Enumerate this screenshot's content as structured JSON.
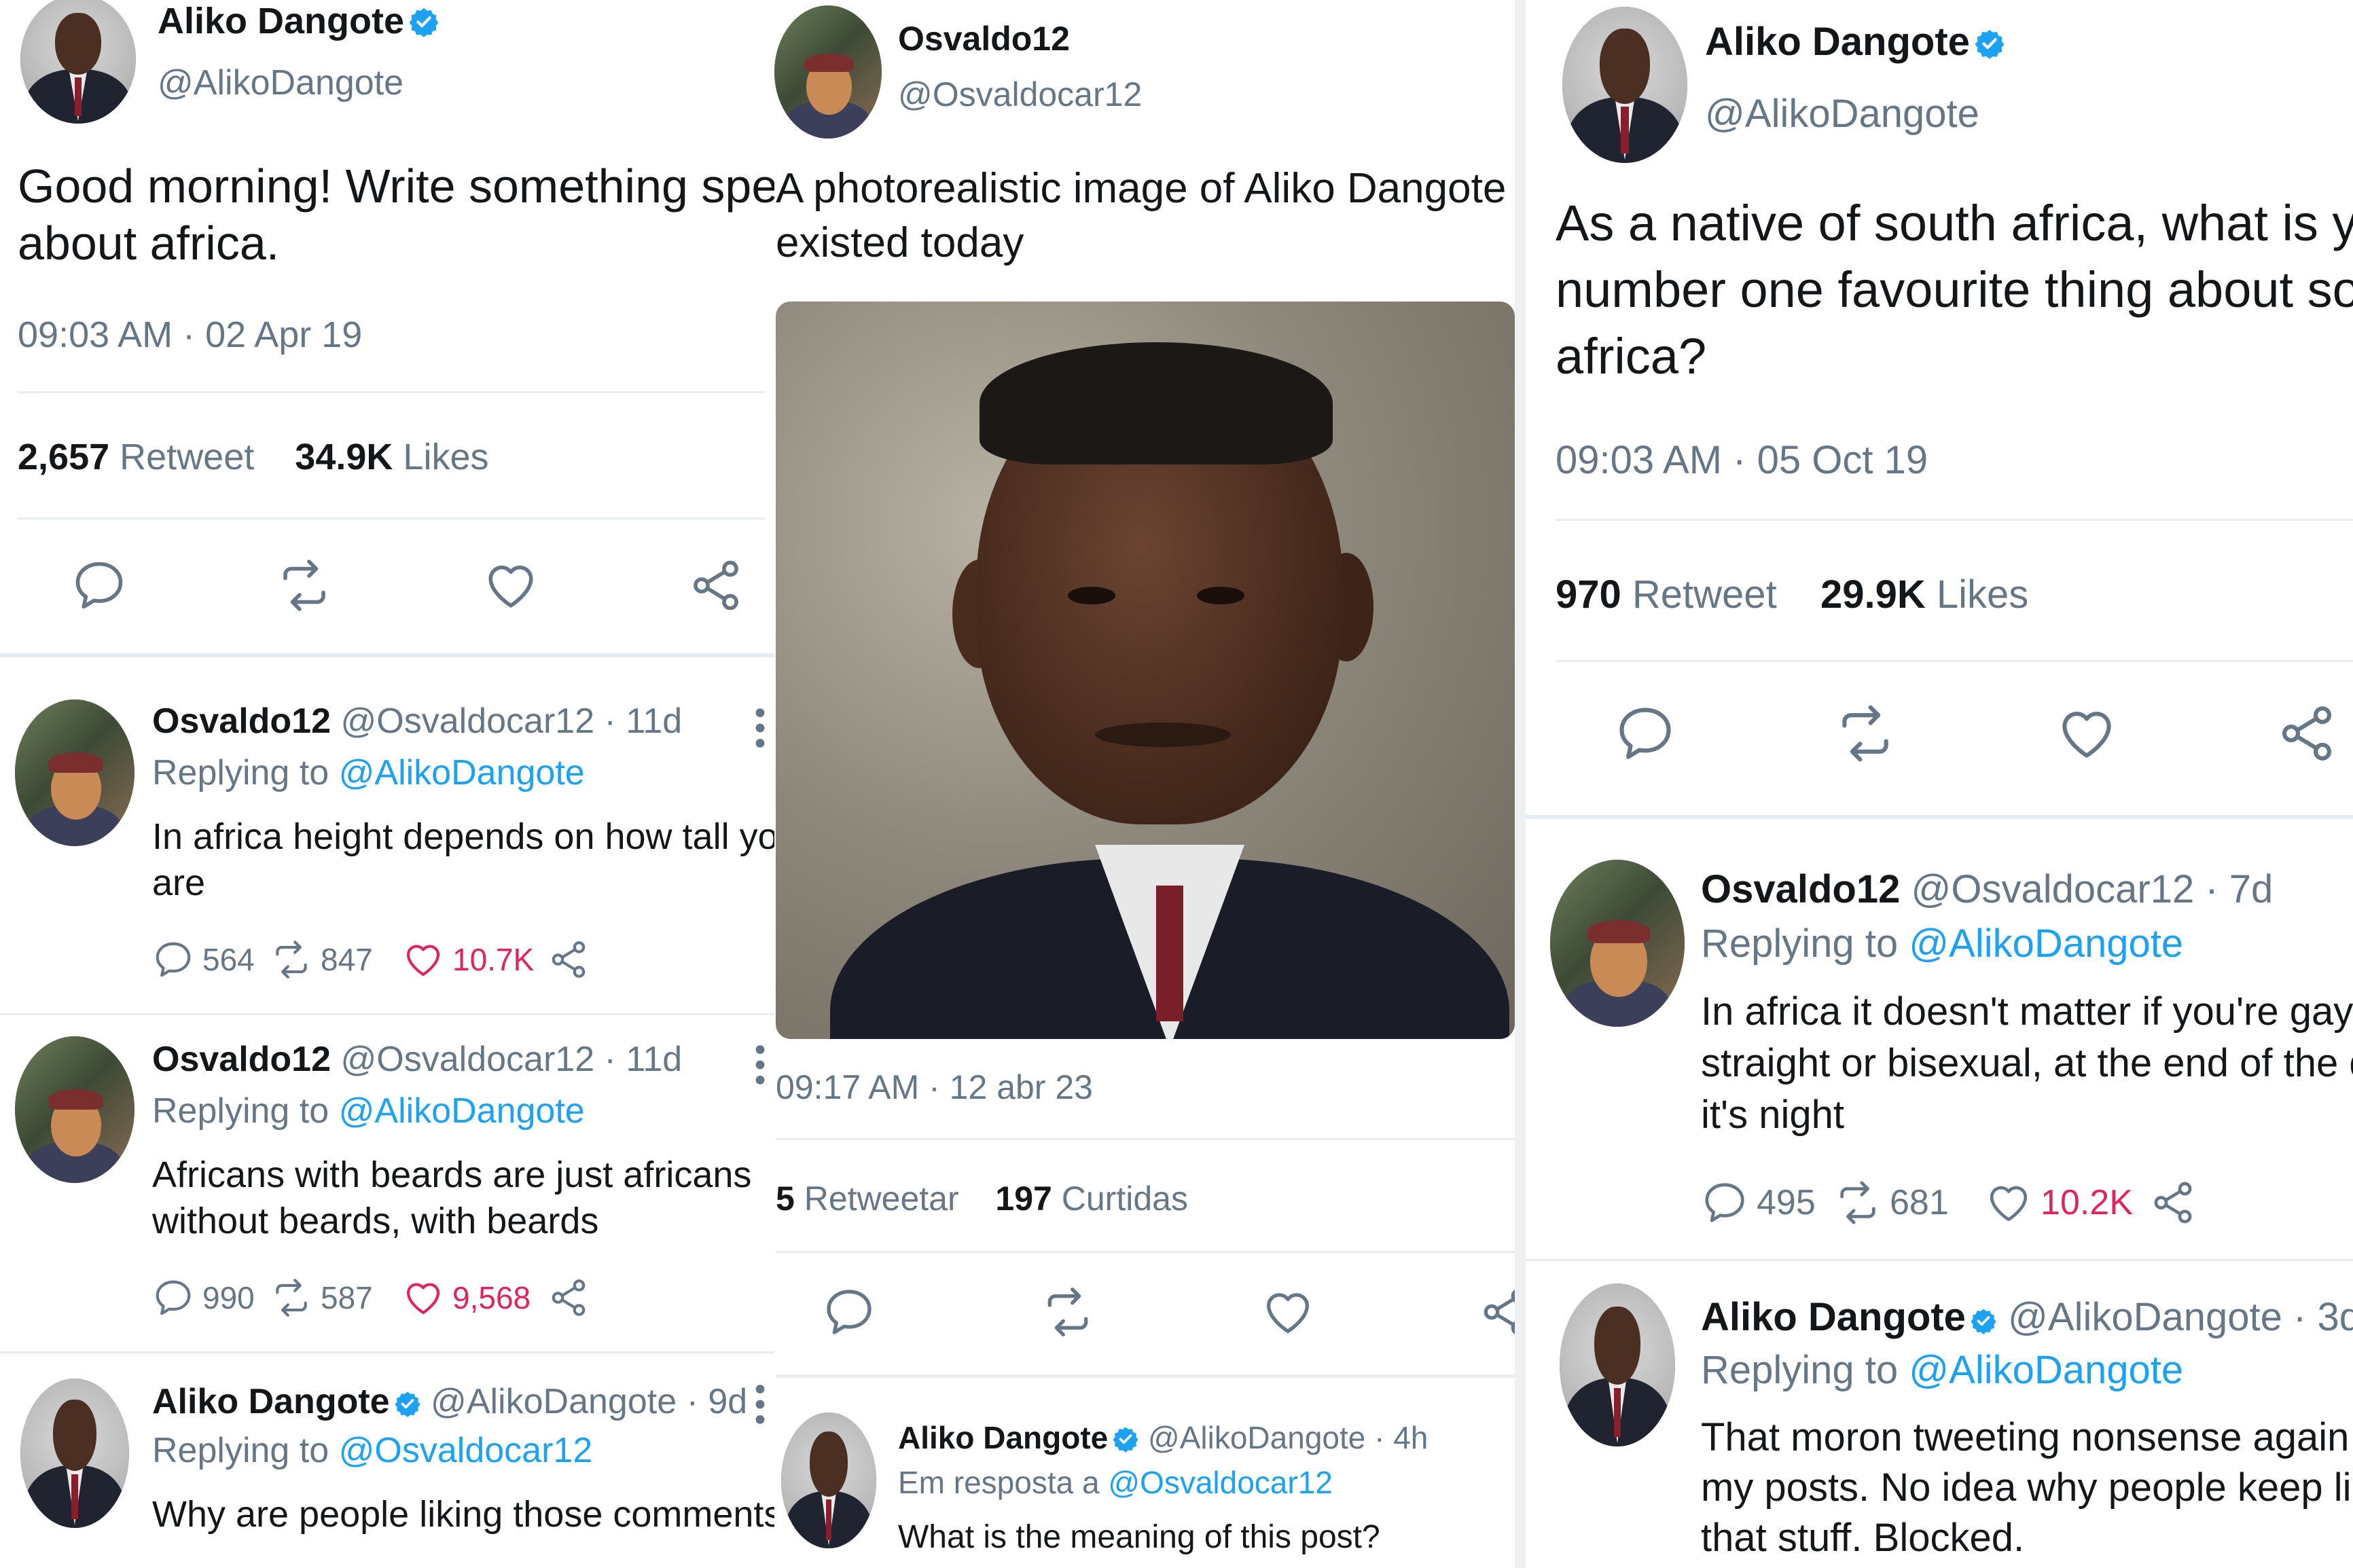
{
  "colors": {
    "accent": "#1da1f2",
    "like_red": "#e0245e",
    "muted": "#657786",
    "verified": "#1da1f2"
  },
  "left": {
    "tweet": {
      "name": "Aliko Dangote",
      "handle": "@AlikoDangote",
      "text_line1": "Good morning! Write something special",
      "text_line2": "about africa.",
      "timestamp": "09:03 AM · 02 Apr 19",
      "retweet_count": "2,657",
      "retweet_label": "Retweet",
      "likes_count": "34.9K",
      "likes_label": "Likes"
    },
    "replies": [
      {
        "name": "Osvaldo12",
        "meta": "@Osvaldocar12 · 11d",
        "replying_prefix": "Replying to",
        "replying_to": "@AlikoDangote",
        "line1": "In africa height depends on how tall you",
        "line2": "are",
        "replies": "564",
        "retweets": "847",
        "likes": "10.7K"
      },
      {
        "name": "Osvaldo12",
        "meta": "@Osvaldocar12 · 11d",
        "replying_prefix": "Replying to",
        "replying_to": "@AlikoDangote",
        "line1": "Africans with beards are just africans",
        "line2": "without beards, with beards",
        "replies": "990",
        "retweets": "587",
        "likes": "9,568"
      },
      {
        "name": "Aliko Dangote",
        "meta": "@AlikoDangote · 9d",
        "replying_prefix": "Replying to",
        "replying_to": "@Osvaldocar12",
        "line1": "Why are people liking those comments?"
      }
    ]
  },
  "middle": {
    "tweet": {
      "name": "Osvaldo12",
      "handle": "@Osvaldocar12",
      "text_line1": "A photorealistic image of Aliko Dangote if he",
      "text_line2": "existed today",
      "timestamp": "09:17 AM · 12 abr 23",
      "retweet_count": "5",
      "retweet_label": "Retweetar",
      "likes_count": "197",
      "likes_label": "Curtidas"
    },
    "reply": {
      "name": "Aliko Dangote",
      "meta": "@AlikoDangote · 4h",
      "replying_prefix": "Em resposta a",
      "replying_to": "@Osvaldocar12",
      "line1": "What is the meaning of this post?"
    }
  },
  "right": {
    "tweet": {
      "name": "Aliko Dangote",
      "handle": "@AlikoDangote",
      "text_line1": "As a native of south africa, what is your",
      "text_line2": "number one favourite thing about south",
      "text_line3": "africa?",
      "timestamp": "09:03 AM · 05 Oct 19",
      "retweet_count": "970",
      "retweet_label": "Retweet",
      "likes_count": "29.9K",
      "likes_label": "Likes"
    },
    "replies": [
      {
        "name": "Osvaldo12",
        "meta": "@Osvaldocar12 · 7d",
        "replying_prefix": "Replying to",
        "replying_to": "@AlikoDangote",
        "line1": "In africa it doesn't matter if you're gay,",
        "line2": "straight or bisexual, at the end of the day,",
        "line3": "it's night",
        "replies": "495",
        "retweets": "681",
        "likes": "10.2K"
      },
      {
        "name": "Aliko Dangote",
        "meta": "@AlikoDangote · 3d",
        "replying_prefix": "Replying to",
        "replying_to": "@AlikoDangote",
        "line1": "That moron tweeting nonsense again in",
        "line2": "my posts. No idea why people keep liking",
        "line3": "that stuff. Blocked."
      }
    ]
  }
}
